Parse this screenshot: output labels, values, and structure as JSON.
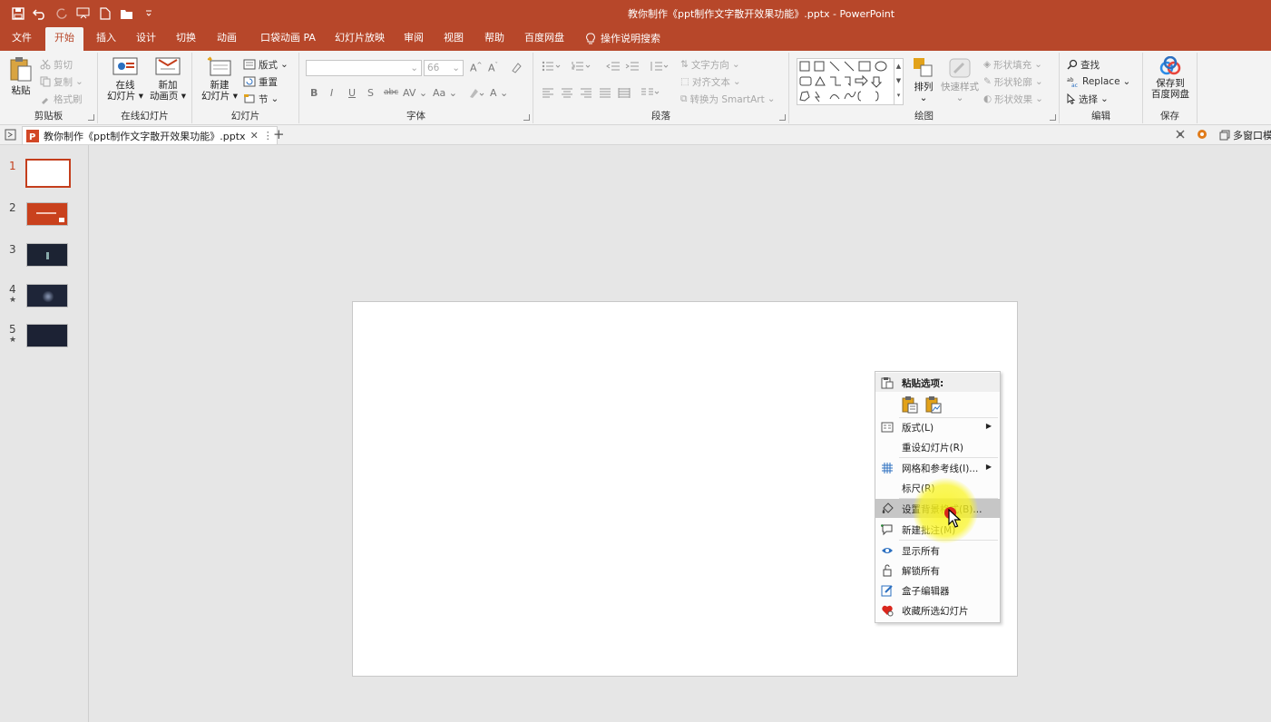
{
  "window": {
    "title": "教你制作《ppt制作文字散开效果功能》.pptx  -  PowerPoint"
  },
  "tabs": [
    "文件",
    "开始",
    "插入",
    "设计",
    "切换",
    "动画",
    "口袋动画 PA",
    "幻灯片放映",
    "审阅",
    "视图",
    "帮助",
    "百度网盘",
    "操作说明搜索"
  ],
  "active_tab": "开始",
  "ribbon": {
    "clipboard": {
      "label": "剪贴板",
      "paste": "粘贴",
      "cut": "剪切",
      "copy": "复制",
      "painter": "格式刷"
    },
    "online": {
      "label": "在线幻灯片",
      "online_btn": "在线\n幻灯片",
      "new_anim": "新加\n动画页"
    },
    "slides": {
      "label": "幻灯片",
      "new_slide": "新建\n幻灯片",
      "layout": "版式",
      "reset": "重置",
      "section": "节"
    },
    "font": {
      "label": "字体",
      "size": "66",
      "bold": "B",
      "italic": "I",
      "underline": "U",
      "shadow": "S",
      "strike": "abc",
      "spacing": "AV",
      "case": "Aa",
      "color": "A"
    },
    "paragraph": {
      "label": "段落",
      "text_dir": "文字方向",
      "align_text": "对齐文本",
      "smartart": "转换为 SmartArt"
    },
    "drawing": {
      "label": "绘图",
      "arrange": "排列",
      "quick_styles": "快速样式",
      "fill": "形状填充",
      "outline": "形状轮廓",
      "effects": "形状效果"
    },
    "editing": {
      "label": "编辑",
      "find": "查找",
      "replace": "Replace",
      "select": "选择"
    },
    "save": {
      "label": "保存",
      "save_btn": "保存到\n百度网盘"
    }
  },
  "docbar": {
    "doc_tab": "教你制作《ppt制作文字散开效果功能》.pptx",
    "multi_window": "多窗口模"
  },
  "thumbnails": [
    {
      "num": "1",
      "star": ""
    },
    {
      "num": "2",
      "star": ""
    },
    {
      "num": "3",
      "star": ""
    },
    {
      "num": "4",
      "star": "★"
    },
    {
      "num": "5",
      "star": "★"
    }
  ],
  "context_menu": {
    "paste_options": "粘贴选项:",
    "items": [
      "版式(L)",
      "重设幻灯片(R)",
      "网格和参考线(I)...",
      "标尺(R)",
      "设置背景格式(B)...",
      "新建批注(M)",
      "显示所有",
      "解锁所有",
      "盒子编辑器",
      "收藏所选幻灯片"
    ],
    "highlighted": "设置背景格式(B)..."
  },
  "colors": {
    "accent": "#b7472a",
    "selected_border": "#c43e1c",
    "menu_highlight": "#c6c6c6"
  }
}
